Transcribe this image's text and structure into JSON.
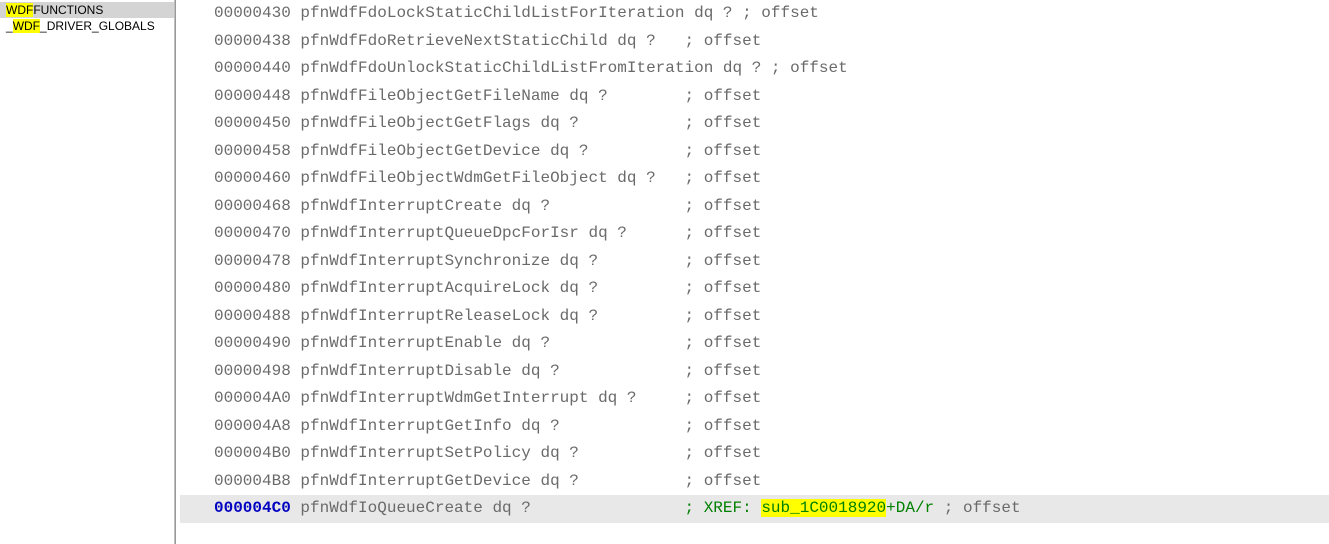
{
  "sidebar": {
    "items": [
      {
        "prefix_hl": "WDF",
        "suffix": "FUNCTIONS",
        "selected": true
      },
      {
        "prefix_u": "_",
        "prefix_hl": "WDF",
        "suffix": "_DRIVER_GLOBALS",
        "selected": false
      }
    ]
  },
  "code": {
    "lines": [
      {
        "offset": "00000430",
        "symbol": "pfnWdfFdoLockStaticChildListForIteration dq ? ; offset",
        "pad": ""
      },
      {
        "offset": "00000438",
        "symbol": "pfnWdfFdoRetrieveNextStaticChild dq ?",
        "pad": "   ",
        "comment": "; offset"
      },
      {
        "offset": "00000440",
        "symbol": "pfnWdfFdoUnlockStaticChildListFromIteration dq ? ; offset",
        "pad": ""
      },
      {
        "offset": "00000448",
        "symbol": "pfnWdfFileObjectGetFileName dq ?",
        "pad": "        ",
        "comment": "; offset"
      },
      {
        "offset": "00000450",
        "symbol": "pfnWdfFileObjectGetFlags dq ?",
        "pad": "           ",
        "comment": "; offset"
      },
      {
        "offset": "00000458",
        "symbol": "pfnWdfFileObjectGetDevice dq ?",
        "pad": "          ",
        "comment": "; offset"
      },
      {
        "offset": "00000460",
        "symbol": "pfnWdfFileObjectWdmGetFileObject dq ?",
        "pad": "   ",
        "comment": "; offset"
      },
      {
        "offset": "00000468",
        "symbol": "pfnWdfInterruptCreate dq ?",
        "pad": "              ",
        "comment": "; offset"
      },
      {
        "offset": "00000470",
        "symbol": "pfnWdfInterruptQueueDpcForIsr dq ?",
        "pad": "      ",
        "comment": "; offset"
      },
      {
        "offset": "00000478",
        "symbol": "pfnWdfInterruptSynchronize dq ?",
        "pad": "         ",
        "comment": "; offset"
      },
      {
        "offset": "00000480",
        "symbol": "pfnWdfInterruptAcquireLock dq ?",
        "pad": "         ",
        "comment": "; offset"
      },
      {
        "offset": "00000488",
        "symbol": "pfnWdfInterruptReleaseLock dq ?",
        "pad": "         ",
        "comment": "; offset"
      },
      {
        "offset": "00000490",
        "symbol": "pfnWdfInterruptEnable dq ?",
        "pad": "              ",
        "comment": "; offset"
      },
      {
        "offset": "00000498",
        "symbol": "pfnWdfInterruptDisable dq ?",
        "pad": "             ",
        "comment": "; offset"
      },
      {
        "offset": "000004A0",
        "symbol": "pfnWdfInterruptWdmGetInterrupt dq ?",
        "pad": "     ",
        "comment": "; offset"
      },
      {
        "offset": "000004A8",
        "symbol": "pfnWdfInterruptGetInfo dq ?",
        "pad": "             ",
        "comment": "; offset"
      },
      {
        "offset": "000004B0",
        "symbol": "pfnWdfInterruptSetPolicy dq ?",
        "pad": "           ",
        "comment": "; offset"
      },
      {
        "offset": "000004B8",
        "symbol": "pfnWdfInterruptGetDevice dq ?",
        "pad": "           ",
        "comment": "; offset"
      }
    ],
    "xref_line": {
      "offset": "000004C0",
      "symbol": "pfnWdfIoQueueCreate dq ?",
      "pad": "                ",
      "xref_label": "; XREF:",
      "xref_sub": "sub_1C0018920",
      "xref_suffix": "+DA/r",
      "xref_tail": " ; offset"
    }
  }
}
